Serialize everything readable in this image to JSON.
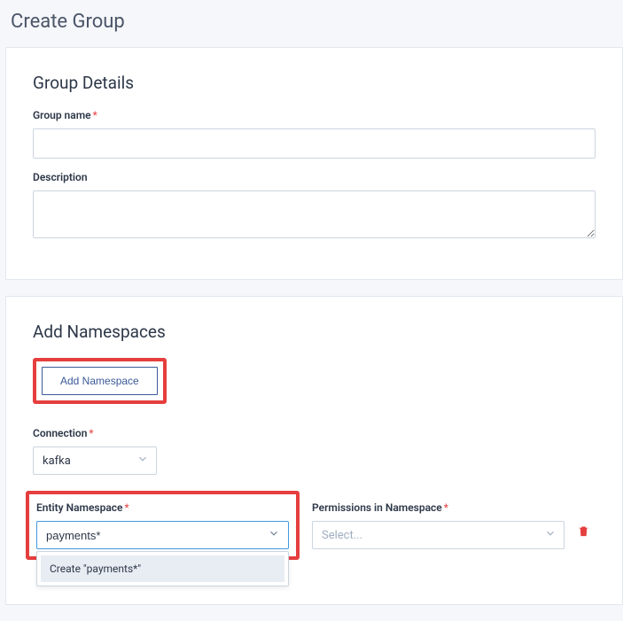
{
  "page": {
    "title": "Create Group"
  },
  "groupDetails": {
    "sectionTitle": "Group Details",
    "groupName": {
      "label": "Group name",
      "value": ""
    },
    "description": {
      "label": "Description",
      "value": ""
    }
  },
  "namespaces": {
    "sectionTitle": "Add Namespaces",
    "addButton": "Add Namespace",
    "connection": {
      "label": "Connection",
      "value": "kafka"
    },
    "entityNamespace": {
      "label": "Entity Namespace",
      "value": "payments*",
      "createOption": "Create \"payments*\""
    },
    "permissions": {
      "label": "Permissions in Namespace",
      "placeholder": "Select..."
    }
  }
}
